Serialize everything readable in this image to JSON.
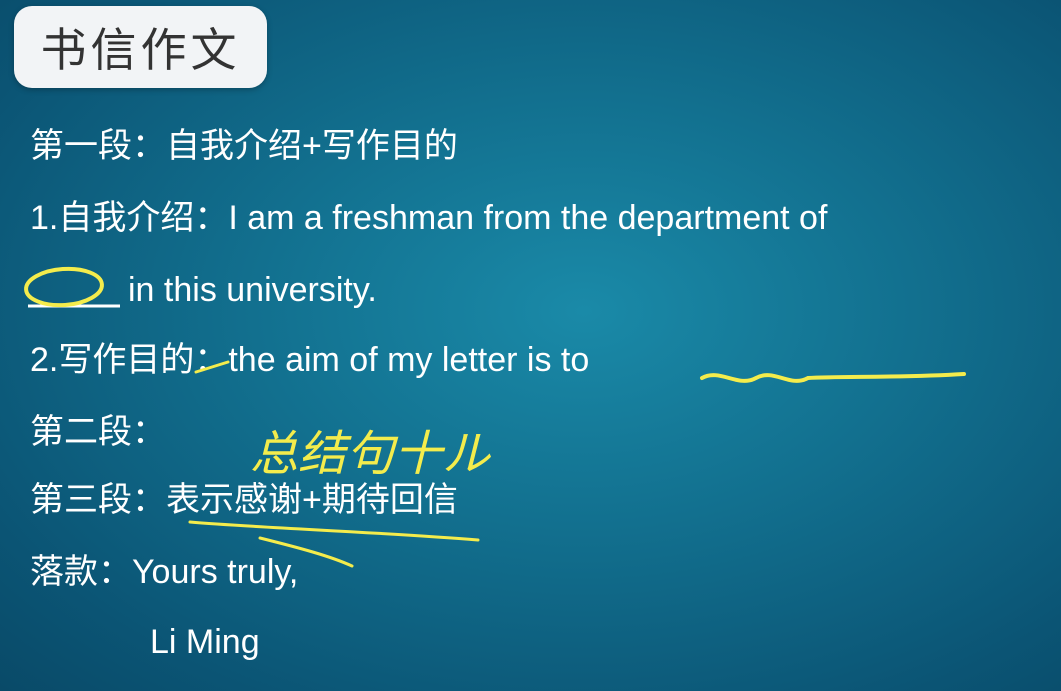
{
  "title": "书信作文",
  "lines": {
    "p1_heading": "第一段：自我介绍+写作目的",
    "p1_item1_a": "1.自我介绍：I am a freshman from the department of",
    "p1_item1_b": "in this university.",
    "p1_item2": "2.写作目的：the aim of my letter is to",
    "p2_heading": "第二段：",
    "p3_heading": "第三段：表示感谢+期待回信",
    "closing_label": "落款：Yours truly,",
    "signature": "Li Ming"
  },
  "handwriting": {
    "note": "总结句十ル"
  },
  "colors": {
    "background": "#12708f",
    "text": "#ffffff",
    "ink": "#f4ec4c",
    "title_box": "#f2f4f6"
  }
}
